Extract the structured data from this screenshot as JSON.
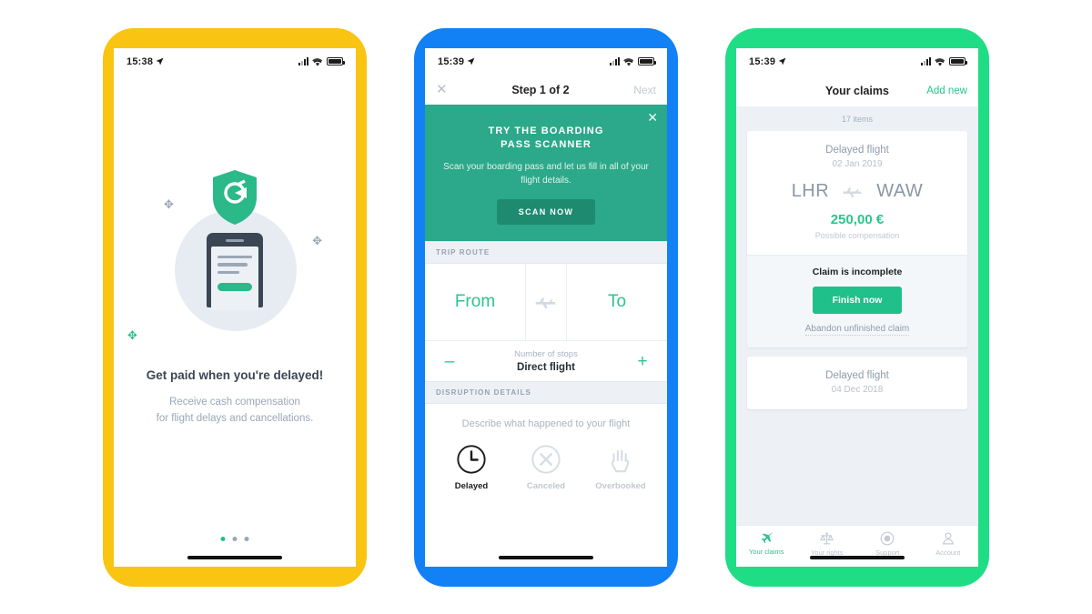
{
  "frames": {
    "phone1_color": "#F9C412",
    "phone2_color": "#1281F5",
    "phone3_color": "#1FDD85"
  },
  "accent": {
    "teal": "#2BC48D",
    "banner_green": "#2BA98A",
    "button_green": "#1E8B70"
  },
  "phone1": {
    "status": {
      "time": "15:38",
      "location_icon": "location-arrow-icon",
      "signal_icon": "signal-bars-icon",
      "wifi_icon": "wifi-icon",
      "battery_icon": "battery-icon"
    },
    "illustration": {
      "shield_icon": "shield-logo-icon",
      "device_icon": "phone-document-icon",
      "sparkles": "sparkle-icon"
    },
    "title": "Get paid when you're delayed!",
    "subtitle_line1": "Receive cash compensation",
    "subtitle_line2": "for flight delays and cancellations.",
    "pager": {
      "total": 3,
      "active_index": 0
    }
  },
  "phone2": {
    "status": {
      "time": "15:39"
    },
    "nav": {
      "close_label": "✕",
      "title": "Step 1 of 2",
      "next_label": "Next"
    },
    "banner": {
      "close_label": "✕",
      "heading_line1": "TRY THE BOARDING",
      "heading_line2": "PASS SCANNER",
      "body": "Scan your boarding pass and let us fill in all of your flight details.",
      "cta": "SCAN NOW"
    },
    "trip_route": {
      "section_title": "TRIP ROUTE",
      "from_label": "From",
      "to_label": "To",
      "plane_icon": "plane-icon",
      "stops_label": "Number of stops",
      "stops_value": "Direct flight",
      "minus_label": "–",
      "plus_label": "+"
    },
    "disruption": {
      "section_title": "DISRUPTION DETAILS",
      "question": "Describe what happened to your flight",
      "options": [
        {
          "label": "Delayed",
          "icon": "clock-icon",
          "selected": true
        },
        {
          "label": "Canceled",
          "icon": "x-circle-icon",
          "selected": false
        },
        {
          "label": "Overbooked",
          "icon": "hand-icon",
          "selected": false
        }
      ]
    }
  },
  "phone3": {
    "status": {
      "time": "15:39"
    },
    "nav": {
      "title": "Your claims",
      "add_new": "Add new"
    },
    "items_count": "17 items",
    "claims": [
      {
        "kind": "Delayed flight",
        "date": "02 Jan 2019",
        "origin": "LHR",
        "destination": "WAW",
        "plane_icon": "plane-icon",
        "amount": "250,00 €",
        "amount_label": "Possible compensation",
        "status_text": "Claim is incomplete",
        "primary_action": "Finish now",
        "secondary_action": "Abandon unfinished claim"
      },
      {
        "kind": "Delayed flight",
        "date": "04 Dec 2018"
      }
    ],
    "tabs": [
      {
        "label": "Your claims",
        "icon": "plane-icon",
        "active": true
      },
      {
        "label": "Your rights",
        "icon": "scales-icon",
        "active": false
      },
      {
        "label": "Support",
        "icon": "support-circle-icon",
        "active": false
      },
      {
        "label": "Account",
        "icon": "person-icon",
        "active": false
      }
    ]
  }
}
